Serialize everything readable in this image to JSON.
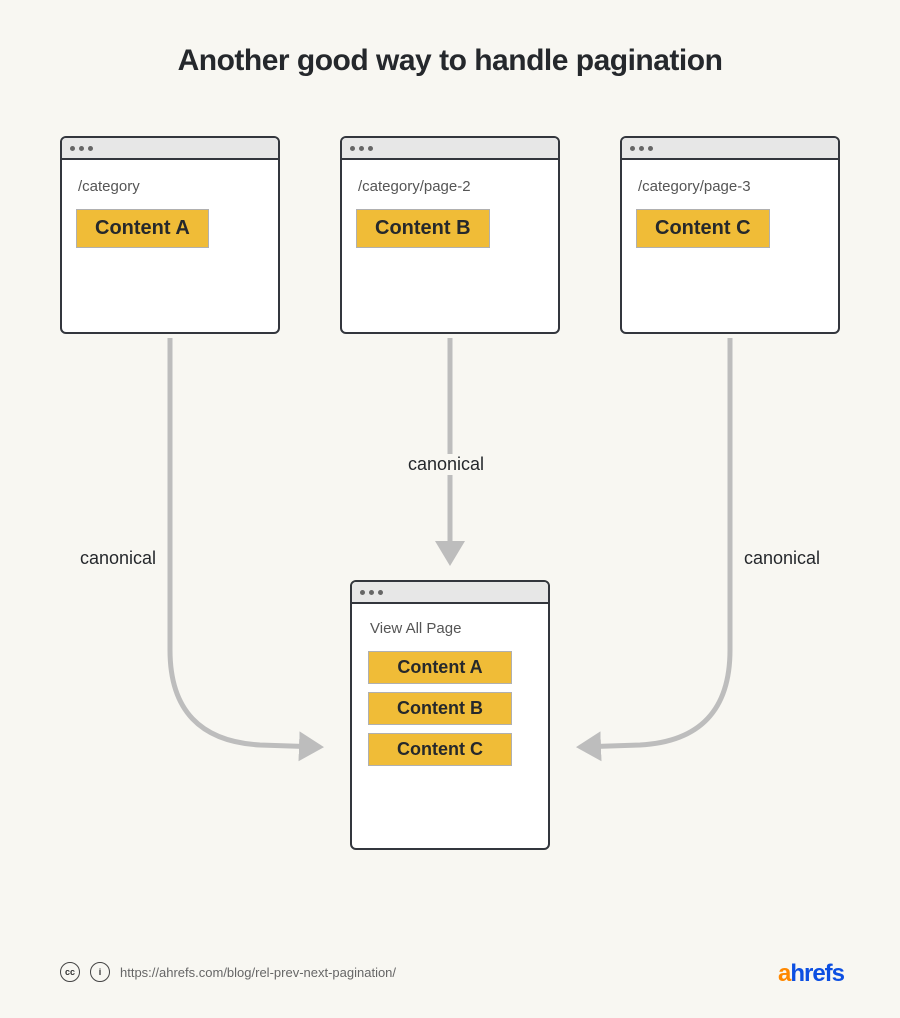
{
  "title": "Another good way to handle pagination",
  "pages": [
    {
      "url": "/category",
      "content": "Content A"
    },
    {
      "url": "/category/page-2",
      "content": "Content B"
    },
    {
      "url": "/category/page-3",
      "content": "Content C"
    }
  ],
  "canonical_label": "canonical",
  "view_all": {
    "title": "View All Page",
    "contents": [
      "Content A",
      "Content B",
      "Content C"
    ]
  },
  "footer": {
    "cc": "cc",
    "by": "i",
    "url": "https://ahrefs.com/blog/rel-prev-next-pagination/"
  },
  "brand": {
    "a": "a",
    "rest": "hrefs"
  }
}
